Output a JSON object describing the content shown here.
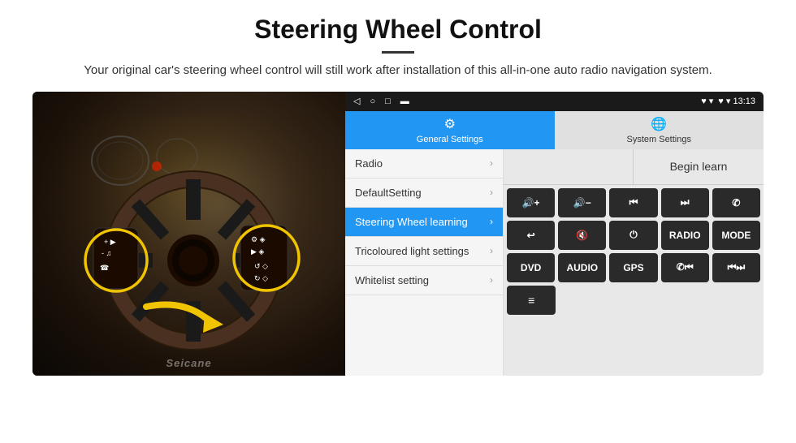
{
  "header": {
    "title": "Steering Wheel Control",
    "subtitle": "Your original car's steering wheel control will still work after installation of this all-in-one auto radio navigation system."
  },
  "status_bar": {
    "left_icons": [
      "◁",
      "○",
      "□",
      "▬"
    ],
    "right_text": "♥ ▾ 13:13"
  },
  "tabs": [
    {
      "label": "General Settings",
      "icon": "⚙",
      "active": true
    },
    {
      "label": "System Settings",
      "icon": "🌐",
      "active": false
    }
  ],
  "menu_items": [
    {
      "label": "Radio",
      "active": false
    },
    {
      "label": "DefaultSetting",
      "active": false
    },
    {
      "label": "Steering Wheel learning",
      "active": true
    },
    {
      "label": "Tricoloured light settings",
      "active": false
    },
    {
      "label": "Whitelist setting",
      "active": false
    }
  ],
  "begin_learn_label": "Begin learn",
  "ctrl_buttons_row1": [
    "🔇+",
    "🔇-",
    "⏮",
    "⏭",
    "📞"
  ],
  "ctrl_buttons_row1_text": [
    "◀+",
    "◀-",
    "⏮",
    "⏭",
    "✆"
  ],
  "ctrl_buttons_row2_text": [
    "↩",
    "◀x",
    "⏻",
    "RADIO",
    "MODE"
  ],
  "ctrl_buttons_row3_text": [
    "DVD",
    "AUDIO",
    "GPS",
    "✆⏮",
    "⏮⏭"
  ],
  "ctrl_buttons_row4_text": [
    "≡"
  ],
  "seicane_watermark": "Seicane"
}
